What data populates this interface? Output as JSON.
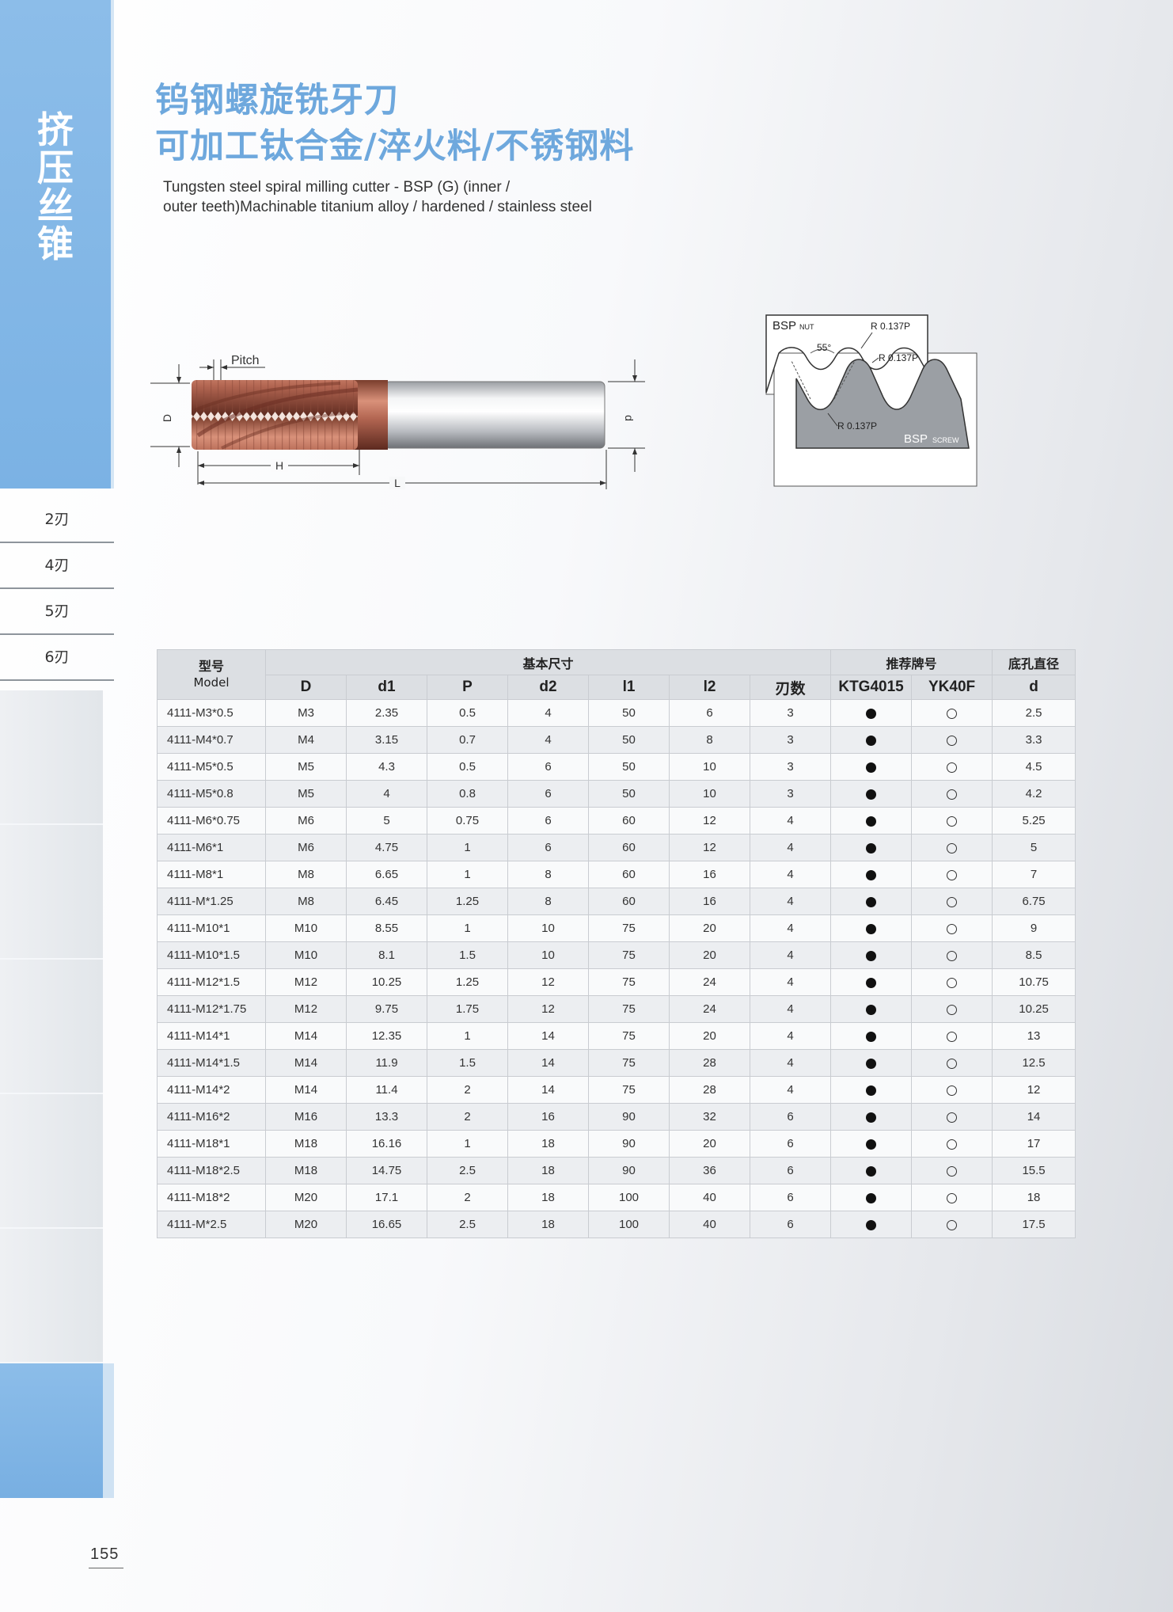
{
  "sidebar": {
    "category_chars": [
      "挤",
      "压",
      "丝",
      "锥"
    ],
    "nav_items": [
      {
        "label": "2刃"
      },
      {
        "label": "4刃"
      },
      {
        "label": "5刃"
      },
      {
        "label": "6刃"
      }
    ]
  },
  "header": {
    "title_cn_line1": "钨钢螺旋铣牙刀",
    "title_cn_line2": "可加工钛合金/淬火料/不锈钢料",
    "title_en_line1": "Tungsten steel spiral milling cutter - BSP (G) (inner /",
    "title_en_line2": "outer teeth)Machinable titanium alloy / hardened / stainless steel"
  },
  "tool_diagram": {
    "pitch_label": "Pitch",
    "d_upper_label": "D",
    "d_lower_label": "d",
    "h_label": "H",
    "l_label": "L"
  },
  "bsp_diagram": {
    "nut_label": "BSP",
    "nut_sub": "NUT",
    "screw_label": "BSP",
    "screw_sub": "SCREW",
    "angle_label": "55°",
    "radius_top": "R 0.137P",
    "radius_mid": "R 0.137P",
    "radius_bottom": "R 0.137P"
  },
  "table": {
    "model_cn": "型号",
    "model_en": "Model",
    "group_basic": "基本尺寸",
    "group_grade": "推荐牌号",
    "group_hole": "底孔直径",
    "cols": [
      "D",
      "d1",
      "P",
      "d2",
      "l1",
      "l2",
      "刃数",
      "KTG4015",
      "YK40F",
      "d"
    ],
    "rows": [
      {
        "model": "4111-M3*0.5",
        "D": "M3",
        "d1": "2.35",
        "P": "0.5",
        "d2": "4",
        "l1": "50",
        "l2": "6",
        "flutes": "3",
        "ktg": "●",
        "yk": "○",
        "d": "2.5"
      },
      {
        "model": "4111-M4*0.7",
        "D": "M4",
        "d1": "3.15",
        "P": "0.7",
        "d2": "4",
        "l1": "50",
        "l2": "8",
        "flutes": "3",
        "ktg": "●",
        "yk": "○",
        "d": "3.3"
      },
      {
        "model": "4111-M5*0.5",
        "D": "M5",
        "d1": "4.3",
        "P": "0.5",
        "d2": "6",
        "l1": "50",
        "l2": "10",
        "flutes": "3",
        "ktg": "●",
        "yk": "○",
        "d": "4.5"
      },
      {
        "model": "4111-M5*0.8",
        "D": "M5",
        "d1": "4",
        "P": "0.8",
        "d2": "6",
        "l1": "50",
        "l2": "10",
        "flutes": "3",
        "ktg": "●",
        "yk": "○",
        "d": "4.2"
      },
      {
        "model": "4111-M6*0.75",
        "D": "M6",
        "d1": "5",
        "P": "0.75",
        "d2": "6",
        "l1": "60",
        "l2": "12",
        "flutes": "4",
        "ktg": "●",
        "yk": "○",
        "d": "5.25"
      },
      {
        "model": "4111-M6*1",
        "D": "M6",
        "d1": "4.75",
        "P": "1",
        "d2": "6",
        "l1": "60",
        "l2": "12",
        "flutes": "4",
        "ktg": "●",
        "yk": "○",
        "d": "5"
      },
      {
        "model": "4111-M8*1",
        "D": "M8",
        "d1": "6.65",
        "P": "1",
        "d2": "8",
        "l1": "60",
        "l2": "16",
        "flutes": "4",
        "ktg": "●",
        "yk": "○",
        "d": "7"
      },
      {
        "model": "4111-M*1.25",
        "D": "M8",
        "d1": "6.45",
        "P": "1.25",
        "d2": "8",
        "l1": "60",
        "l2": "16",
        "flutes": "4",
        "ktg": "●",
        "yk": "○",
        "d": "6.75"
      },
      {
        "model": "4111-M10*1",
        "D": "M10",
        "d1": "8.55",
        "P": "1",
        "d2": "10",
        "l1": "75",
        "l2": "20",
        "flutes": "4",
        "ktg": "●",
        "yk": "○",
        "d": "9"
      },
      {
        "model": "4111-M10*1.5",
        "D": "M10",
        "d1": "8.1",
        "P": "1.5",
        "d2": "10",
        "l1": "75",
        "l2": "20",
        "flutes": "4",
        "ktg": "●",
        "yk": "○",
        "d": "8.5"
      },
      {
        "model": "4111-M12*1.5",
        "D": "M12",
        "d1": "10.25",
        "P": "1.25",
        "d2": "12",
        "l1": "75",
        "l2": "24",
        "flutes": "4",
        "ktg": "●",
        "yk": "○",
        "d": "10.75"
      },
      {
        "model": "4111-M12*1.75",
        "D": "M12",
        "d1": "9.75",
        "P": "1.75",
        "d2": "12",
        "l1": "75",
        "l2": "24",
        "flutes": "4",
        "ktg": "●",
        "yk": "○",
        "d": "10.25"
      },
      {
        "model": "4111-M14*1",
        "D": "M14",
        "d1": "12.35",
        "P": "1",
        "d2": "14",
        "l1": "75",
        "l2": "20",
        "flutes": "4",
        "ktg": "●",
        "yk": "○",
        "d": "13"
      },
      {
        "model": "4111-M14*1.5",
        "D": "M14",
        "d1": "11.9",
        "P": "1.5",
        "d2": "14",
        "l1": "75",
        "l2": "28",
        "flutes": "4",
        "ktg": "●",
        "yk": "○",
        "d": "12.5"
      },
      {
        "model": "4111-M14*2",
        "D": "M14",
        "d1": "11.4",
        "P": "2",
        "d2": "14",
        "l1": "75",
        "l2": "28",
        "flutes": "4",
        "ktg": "●",
        "yk": "○",
        "d": "12"
      },
      {
        "model": "4111-M16*2",
        "D": "M16",
        "d1": "13.3",
        "P": "2",
        "d2": "16",
        "l1": "90",
        "l2": "32",
        "flutes": "6",
        "ktg": "●",
        "yk": "○",
        "d": "14"
      },
      {
        "model": "4111-M18*1",
        "D": "M18",
        "d1": "16.16",
        "P": "1",
        "d2": "18",
        "l1": "90",
        "l2": "20",
        "flutes": "6",
        "ktg": "●",
        "yk": "○",
        "d": "17"
      },
      {
        "model": "4111-M18*2.5",
        "D": "M18",
        "d1": "14.75",
        "P": "2.5",
        "d2": "18",
        "l1": "90",
        "l2": "36",
        "flutes": "6",
        "ktg": "●",
        "yk": "○",
        "d": "15.5"
      },
      {
        "model": "4111-M18*2",
        "D": "M20",
        "d1": "17.1",
        "P": "2",
        "d2": "18",
        "l1": "100",
        "l2": "40",
        "flutes": "6",
        "ktg": "●",
        "yk": "○",
        "d": "18"
      },
      {
        "model": "4111-M*2.5",
        "D": "M20",
        "d1": "16.65",
        "P": "2.5",
        "d2": "18",
        "l1": "100",
        "l2": "40",
        "flutes": "6",
        "ktg": "●",
        "yk": "○",
        "d": "17.5"
      }
    ]
  },
  "footer": {
    "page_number": "155"
  }
}
